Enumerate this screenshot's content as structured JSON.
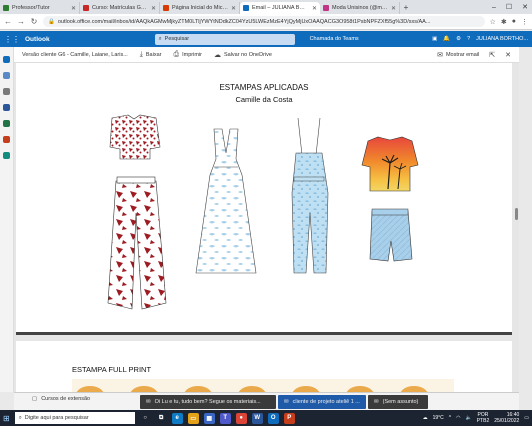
{
  "browser": {
    "tabs": [
      {
        "title": "Professor/Tutor",
        "color": "#2e7d32"
      },
      {
        "title": "Curso: Matrículas Gradua...",
        "color": "#c62828"
      },
      {
        "title": "Página Inicial do Microso...",
        "color": "#d83b01"
      },
      {
        "title": "Email – JULIANA BORTHO...",
        "color": "#0f6cbd"
      },
      {
        "title": "Moda Unisinos (@moda...",
        "color": "#c13584"
      }
    ],
    "active_tab": 3,
    "new_tab_symbol": "+",
    "window_controls": [
      "–",
      "☐",
      "✕"
    ],
    "url": "outlook.office.com/mail/inbox/id/AAQkAGMwMjkyZTM0LTljYWYtNDdkZC04YzU5LWEzMzE4YjQyMjUxOAAQACG3O958t1PsbNPFZXf55g%3D/sxs/AA..."
  },
  "outlook": {
    "app_name": "Outlook",
    "search_placeholder": "Pesquisar",
    "teams_call": "Chamada do Teams",
    "user_name": "JULIANA BORTHO..."
  },
  "preview_toolbar": {
    "file_name": "Versão cliente G6 - Camille, Laiane, Laris...",
    "download": "Baixar",
    "print": "Imprimir",
    "save_onedrive": "Salvar no OneDrive",
    "show_email": "Mostrar email"
  },
  "document": {
    "page1_title": "ESTAMPAS APLICADAS",
    "page1_subtitle": "Camille da Costa",
    "page2_title": "ESTAMPA FULL PRINT"
  },
  "notifications": {
    "extension_course": "Cursos de extensão",
    "toast1": "Oi Lu e tu, tudo bem? Segue os materiais...",
    "toast2": "cliente de projeto ateliê 1 ...",
    "toast3": "(Sem assunto)"
  },
  "taskbar": {
    "search_placeholder": "Digite aqui para pesquisar",
    "weather": "19°C",
    "lang_top": "POR",
    "lang_bottom": "PTB2",
    "time": "16:40",
    "date": "25/01/2022"
  },
  "colors": {
    "outlook_blue": "#0f6cbd",
    "taskbar": "#1c2331",
    "print_red": "#9e1b22",
    "print_blue": "#a8cfe9",
    "sunset_orange": "#f08a2c"
  }
}
